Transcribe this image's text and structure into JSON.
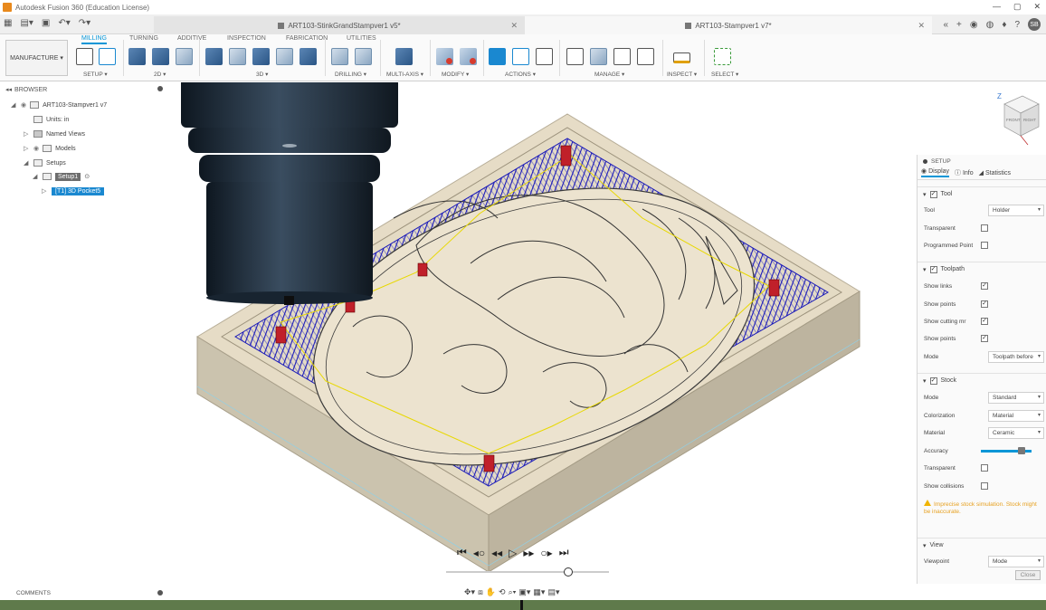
{
  "titlebar": {
    "title": "Autodesk Fusion 360 (Education License)",
    "min": "—",
    "max": "▢",
    "close": "✕"
  },
  "quick_access": {
    "grid": "▦",
    "file": "▤▾",
    "save": "▣",
    "undo": "↶▾",
    "redo": "↷▾"
  },
  "tabs": [
    {
      "label": "ART103-StinkGrandStampver1 v5*",
      "close": "✕",
      "active": false
    },
    {
      "label": "ART103-Stampver1 v7*",
      "close": "✕",
      "active": true
    }
  ],
  "top_right": {
    "overflow": "«",
    "new_tab": "+",
    "online": "◉",
    "jobs": "◍",
    "notify": "♦",
    "help": "?",
    "user_initials": "SB"
  },
  "workspace": {
    "label": "MANUFACTURE ▾"
  },
  "ribbon": {
    "tabs": [
      "MILLING",
      "TURNING",
      "ADDITIVE",
      "INSPECTION",
      "FABRICATION",
      "UTILITIES"
    ],
    "groups": [
      "SETUP ▾",
      "2D ▾",
      "3D ▾",
      "DRILLING ▾",
      "MULTI-AXIS ▾",
      "MODIFY ▾",
      "ACTIONS ▾",
      "MANAGE ▾",
      "INSPECT ▾",
      "SELECT ▾"
    ]
  },
  "browser": {
    "title": "BROWSER",
    "collapse": "◂◂",
    "items": [
      {
        "label": "ART103-Stampver1 v7",
        "level": 0,
        "expander": "◢"
      },
      {
        "label": "Units: in",
        "level": 1,
        "expander": ""
      },
      {
        "label": "Named Views",
        "level": 1,
        "expander": "▷"
      },
      {
        "label": "Models",
        "level": 1,
        "expander": "▷"
      },
      {
        "label": "Setups",
        "level": 1,
        "expander": "◢"
      },
      {
        "label": "Setup1",
        "level": 2,
        "expander": "◢"
      },
      {
        "label": "[T1] 3D Pocket5",
        "level": 3,
        "expander": "▷"
      }
    ]
  },
  "setup_panel": {
    "title": "SETUP",
    "tabs": [
      "Display",
      "Info",
      "Statistics"
    ],
    "sections": {
      "tool": {
        "header": "Tool",
        "collapse": "▾",
        "checked": "✓",
        "rows": [
          {
            "label": "Tool",
            "type": "select",
            "value": "Holder"
          },
          {
            "label": "Transparent",
            "type": "check",
            "value": ""
          },
          {
            "label": "Programmed Point",
            "type": "check",
            "value": ""
          }
        ]
      },
      "toolpath": {
        "header": "Toolpath",
        "collapse": "▾",
        "checked": "✓",
        "rows": [
          {
            "label": "Show links",
            "type": "check",
            "value": "✓"
          },
          {
            "label": "Show points",
            "type": "check",
            "value": "✓"
          },
          {
            "label": "Show cutting mr",
            "type": "check",
            "value": "✓"
          },
          {
            "label": "Show points",
            "type": "check",
            "value": "✓"
          },
          {
            "label": "Mode",
            "type": "select",
            "value": "Toolpath before"
          }
        ]
      },
      "stock": {
        "header": "Stock",
        "collapse": "▾",
        "checked": "✓",
        "rows": [
          {
            "label": "Mode",
            "type": "select",
            "value": "Standard"
          },
          {
            "label": "Colorization",
            "type": "select",
            "value": "Material"
          },
          {
            "label": "Material",
            "type": "select",
            "value": "Ceramic"
          },
          {
            "label": "Accuracy",
            "type": "slider",
            "value": 0.8
          },
          {
            "label": "Transparent",
            "type": "check",
            "value": ""
          },
          {
            "label": "Show collisions",
            "type": "check",
            "value": ""
          }
        ],
        "warning": "Imprecise stock simulation. Stock might be inaccurate."
      },
      "view": {
        "header": "View",
        "collapse": "▾",
        "rows": [
          {
            "label": "Viewpoint",
            "type": "select",
            "value": "Mode"
          }
        ]
      }
    },
    "close_button": "Close"
  },
  "viewcube": {
    "labels": [
      "FRONT",
      "RIGHT"
    ],
    "axis": "Z"
  },
  "comments": {
    "label": "COMMENTS"
  },
  "playback": {
    "start": "⏮",
    "prev_op": "◂○",
    "rewind": "◂◂",
    "play": "▷",
    "forward": "▸▸",
    "next_op": "○▸",
    "end": "⏭"
  },
  "simulation": {
    "position": 0.75
  },
  "nav_toolbar": {
    "items": [
      "✥▾",
      "⧈",
      "✋",
      "⟲",
      "⌕▾",
      "▣▾",
      "▦▾",
      "▤▾"
    ]
  },
  "colors": {
    "accent": "#0696d7",
    "toolpath": "#1a1ab8",
    "stock_top": "#e8dcc5",
    "stock_side": "#c9c0ab",
    "clamp": "#c0202a",
    "spindle": "#1f2d3a"
  }
}
